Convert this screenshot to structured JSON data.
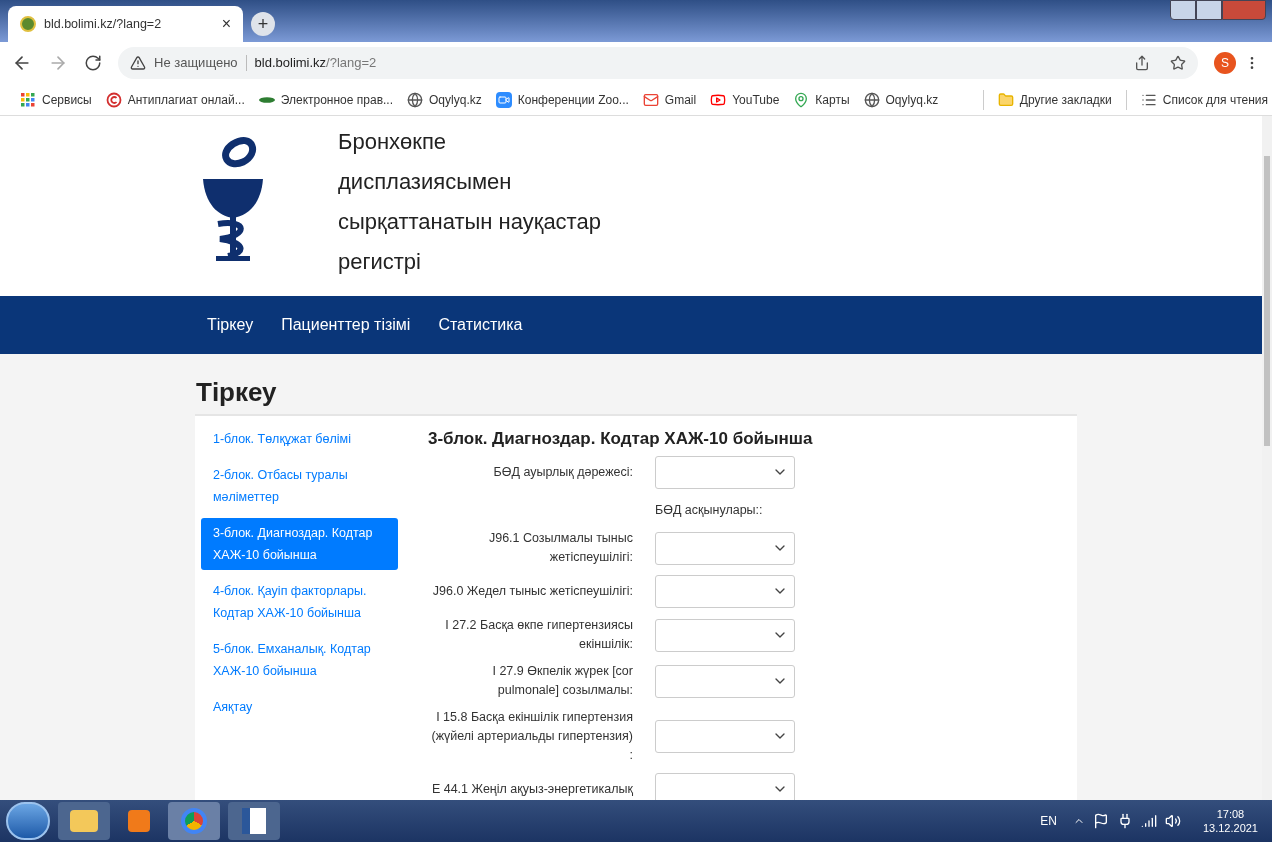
{
  "browser": {
    "tab": {
      "title": "bld.bolimi.kz/?lang=2",
      "close": "×",
      "new_tab": "+"
    },
    "security": "Не защищено",
    "url_host": "bld.bolimi.kz",
    "url_path": "/?lang=2",
    "profile": "S",
    "bookmarks": [
      {
        "label": "Сервисы",
        "kind": "apps"
      },
      {
        "label": "Антиплагиат онлай...",
        "kind": "copyright"
      },
      {
        "label": "Электронное прав...",
        "kind": "egov"
      },
      {
        "label": "Oqylyq.kz",
        "kind": "globe"
      },
      {
        "label": "Конференции Zoo...",
        "kind": "zoom"
      },
      {
        "label": "Gmail",
        "kind": "gmail"
      },
      {
        "label": "YouTube",
        "kind": "youtube"
      },
      {
        "label": "Карты",
        "kind": "maps"
      },
      {
        "label": "Oqylyq.kz",
        "kind": "globe"
      }
    ],
    "other_bookmarks": "Другие закладки",
    "reading_list": "Список для чтения"
  },
  "site": {
    "title_lines": [
      "Бронхөкпе",
      "дисплазиясымен",
      "сырқаттанатын науқастар",
      "регистрі"
    ],
    "nav": [
      "Тіркеу",
      "Пациенттер тізімі",
      "Статистика"
    ]
  },
  "page_title": "Тіркеу",
  "sidebar": [
    {
      "label": "1-блок. Төлқұжат бөлімі",
      "selected": false
    },
    {
      "label": "2-блок. Отбасы туралы мәліметтер",
      "selected": false
    },
    {
      "label": "3-блок. Диагноздар. Кодтар ХАЖ-10 бойынша",
      "selected": true
    },
    {
      "label": "4-блок. Қауіп факторлары. Кодтар ХАЖ-10 бойынша",
      "selected": false
    },
    {
      "label": "5-блок. Емханалық. Кодтар ХАЖ-10 бойынша",
      "selected": false
    },
    {
      "label": "Аяқтау",
      "selected": false
    }
  ],
  "form": {
    "title": "3-блок. Диагноздар. Кодтар ХАЖ-10 бойынша",
    "rows": [
      {
        "kind": "select",
        "label": "БӨД ауырлық дәрежесі:"
      },
      {
        "kind": "heading",
        "label": "БӨД асқынулары::"
      },
      {
        "kind": "select",
        "label": "J96.1 Созылмалы тыныс жетіспеушілігі:"
      },
      {
        "kind": "select",
        "label": "J96.0 Жедел тыныс жетіспеушілігі:"
      },
      {
        "kind": "select",
        "label": "I 27.2 Басқа өкпе гипертензиясы екіншілік:"
      },
      {
        "kind": "select",
        "label": "I 27.9 Өкпелік жүрек [cor pulmonale] созылмалы:"
      },
      {
        "kind": "select",
        "label": "I 15.8 Басқа екіншілік гипертензия (жүйелі артериальды гипертензия) :"
      },
      {
        "kind": "select",
        "label": "E 44.1 Жеңіл ақуыз-энергетикалық"
      }
    ]
  },
  "taskbar": {
    "language": "EN",
    "time": "17:08",
    "date": "13.12.2021"
  }
}
